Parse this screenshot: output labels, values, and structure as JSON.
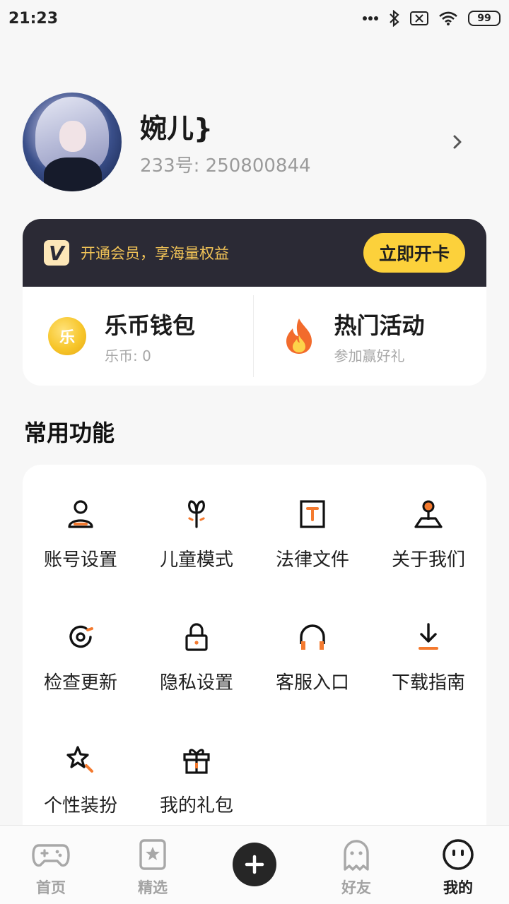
{
  "status_bar": {
    "time": "21:23",
    "battery": "99",
    "icons": [
      "more-dots-icon",
      "bluetooth-icon",
      "no-sim-icon",
      "wifi-icon",
      "battery-icon"
    ]
  },
  "profile": {
    "name": "婉儿}",
    "id_text": "233号: 250800844"
  },
  "vip": {
    "logo": "V",
    "text": "开通会员，享海量权益",
    "button": "立即开卡"
  },
  "wallet": {
    "title": "乐币钱包",
    "sub": "乐币: 0",
    "coin_char": "乐"
  },
  "activity": {
    "title": "热门活动",
    "sub": "参加赢好礼"
  },
  "section": {
    "title": "常用功能"
  },
  "functions": [
    {
      "label": "账号设置",
      "icon": "user-icon"
    },
    {
      "label": "儿童模式",
      "icon": "sprout-icon"
    },
    {
      "label": "法律文件",
      "icon": "document-t-icon"
    },
    {
      "label": "关于我们",
      "icon": "location-pin-icon"
    },
    {
      "label": "检查更新",
      "icon": "update-icon"
    },
    {
      "label": "隐私设置",
      "icon": "lock-icon"
    },
    {
      "label": "客服入口",
      "icon": "headphones-icon"
    },
    {
      "label": "下载指南",
      "icon": "download-icon"
    },
    {
      "label": "个性装扮",
      "icon": "star-wand-icon"
    },
    {
      "label": "我的礼包",
      "icon": "gift-icon"
    }
  ],
  "nav": {
    "home": "首页",
    "featured": "精选",
    "friends": "好友",
    "mine": "我的"
  },
  "colors": {
    "accent": "#f47a2f",
    "vip_bg": "#2b2a35",
    "vip_text": "#f1c357",
    "vip_button": "#fcd13b"
  }
}
